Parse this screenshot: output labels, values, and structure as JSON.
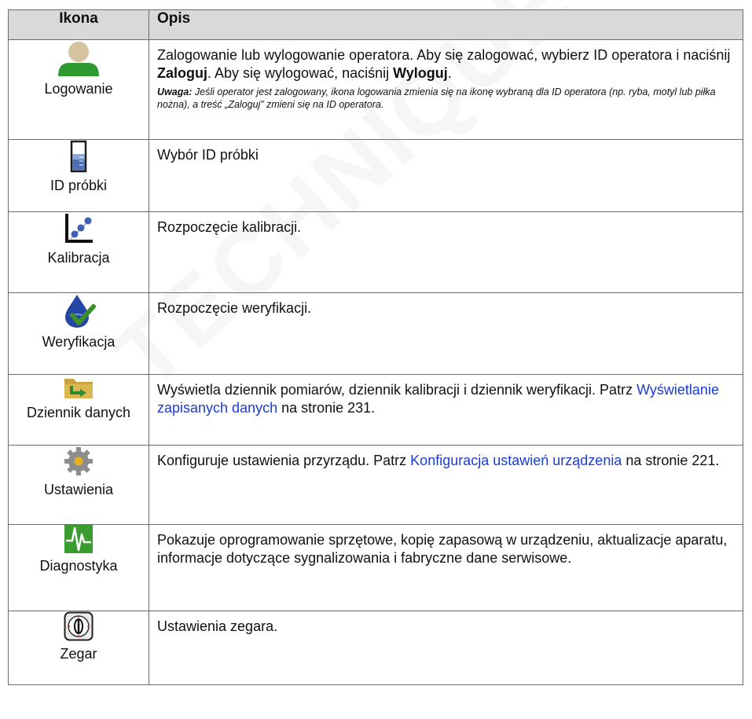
{
  "table": {
    "header": {
      "icon_col": "Ikona",
      "desc_col": "Opis"
    },
    "rows": [
      {
        "label": "Logowanie",
        "icon": "user-icon",
        "desc_a": "Zalogowanie lub wylogowanie operatora. Aby się zalogować, wybierz ID operatora i naciśnij ",
        "desc_b": "Zaloguj",
        "desc_c": ". Aby się wylogować, naciśnij ",
        "desc_d": "Wyloguj",
        "desc_e": ".",
        "note_label": "Uwaga:",
        "note_text": " Jeśli operator jest zalogowany, ikona logowania zmienia się na ikonę wybraną dla ID operatora (np. ryba, motyl lub piłka nożna), a treść „Zaloguj” zmieni się na ID operatora."
      },
      {
        "label": "ID próbki",
        "icon": "sample-beaker-icon",
        "desc": "Wybór ID próbki"
      },
      {
        "label": "Kalibracja",
        "icon": "calibration-graph-icon",
        "desc": "Rozpoczęcie kalibracji."
      },
      {
        "label": "Weryfikacja",
        "icon": "drop-check-icon",
        "desc": "Rozpoczęcie weryfikacji."
      },
      {
        "label": "Dziennik danych",
        "icon": "folder-arrow-icon",
        "desc_a": "Wyświetla dziennik pomiarów, dziennik kalibracji i dziennik weryfikacji. Patrz ",
        "link": "Wyświetlanie zapisanych danych",
        "desc_b": " na stronie 231."
      },
      {
        "label": "Ustawienia",
        "icon": "gear-icon",
        "desc_a": "Konfiguruje ustawienia przyrządu. Patrz ",
        "link": "Konfiguracja ustawień urządzenia",
        "desc_b": " na stronie 221."
      },
      {
        "label": "Diagnostyka",
        "icon": "waveform-icon",
        "desc": "Pokazuje oprogramowanie sprzętowe, kopię zapasową w urządzeniu, aktualizacje aparatu, informacje dotyczące sygnalizowania i fabryczne dane serwisowe."
      },
      {
        "label": "Zegar",
        "icon": "clock-icon",
        "desc": "Ustawienia zegara."
      }
    ]
  },
  "watermark": "TECHNIQUE DUTSCHER SAS",
  "colors": {
    "header_bg": "#d9d9d9",
    "link": "#1a3bd6",
    "grid": "#6b6b6b"
  }
}
